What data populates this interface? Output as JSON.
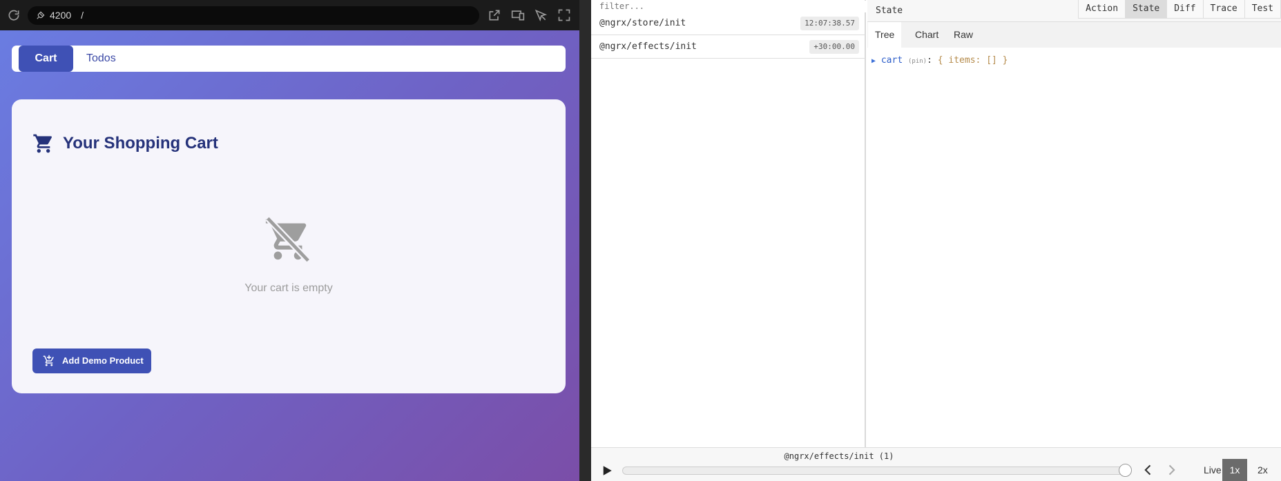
{
  "browser": {
    "port": "4200",
    "path": "/"
  },
  "app": {
    "nav": {
      "cart_label": "Cart",
      "todos_label": "Todos"
    },
    "card": {
      "title": "Your Shopping Cart",
      "empty_text": "Your cart is empty",
      "add_button_label": "Add Demo Product"
    }
  },
  "devtools": {
    "filter_placeholder": "filter...",
    "actions": [
      {
        "name": "@ngrx/store/init",
        "time": "12:07:38.57"
      },
      {
        "name": "@ngrx/effects/init",
        "time": "+30:00.00"
      }
    ],
    "state_label": "State",
    "mode_tabs": [
      "Action",
      "State",
      "Diff",
      "Trace",
      "Test"
    ],
    "active_mode": "State",
    "view_tabs": [
      "Tree",
      "Chart",
      "Raw"
    ],
    "active_view": "Tree",
    "tree": {
      "key": "cart",
      "pin": "(pin)",
      "value": "{ items: [] }"
    },
    "footer": {
      "current_action": "@ngrx/effects/init (1)",
      "speeds": [
        "Live",
        "1x",
        "2x"
      ],
      "active_speed": "1x"
    }
  },
  "colors": {
    "primary": "#3f51b5",
    "title": "#25327a",
    "gradient_start": "#6a7ee3",
    "gradient_end": "#7b4ea8"
  },
  "icons": [
    "reload-icon",
    "plug-icon",
    "open-external-icon",
    "devices-icon",
    "inspect-icon",
    "fullscreen-icon",
    "shopping-cart-icon",
    "remove-shopping-cart-icon",
    "add-shopping-cart-icon",
    "play-icon",
    "chevron-left-icon",
    "chevron-right-icon"
  ]
}
